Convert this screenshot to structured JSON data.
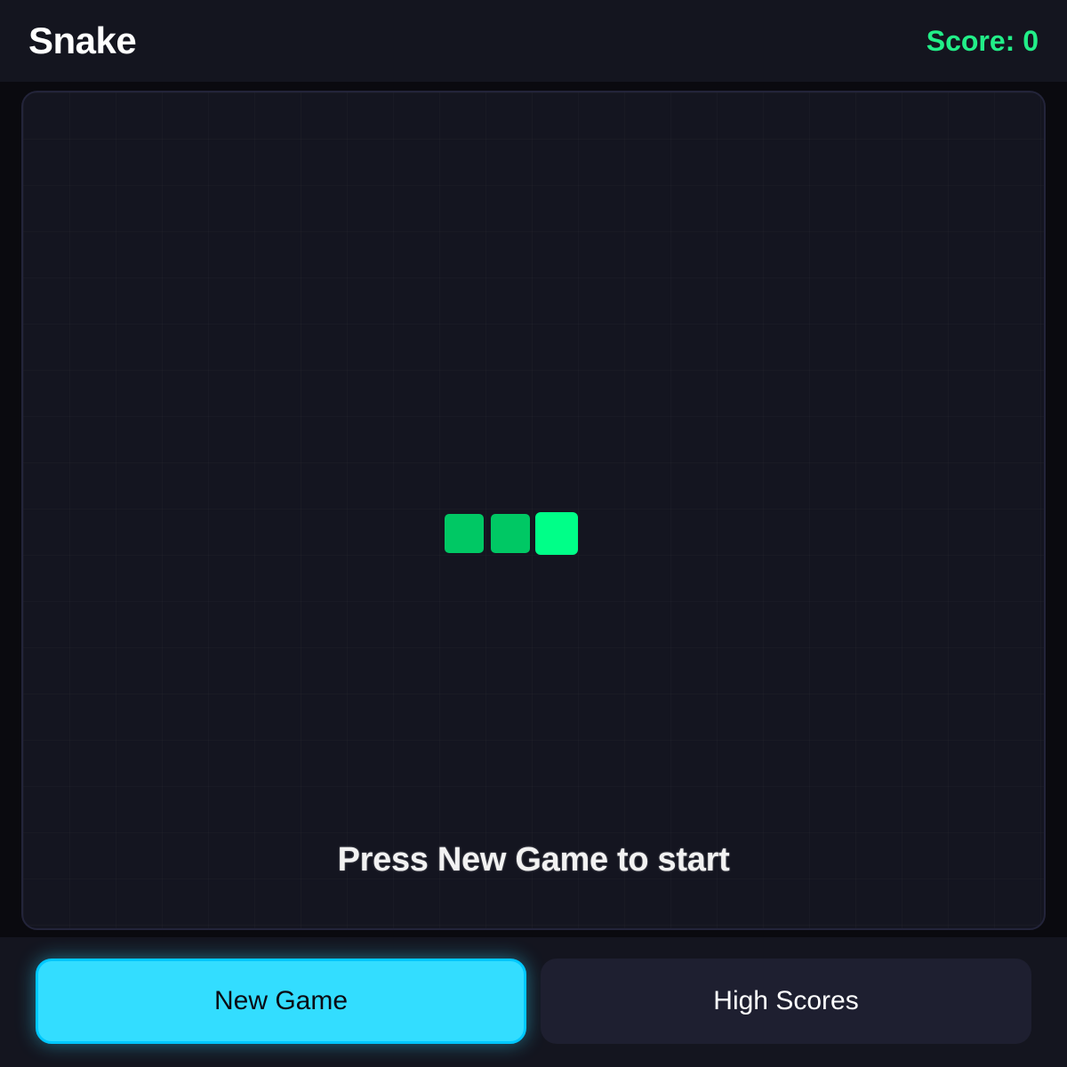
{
  "header": {
    "title": "Snake",
    "score_label": "Score: 0"
  },
  "board": {
    "message": "Press New Game to start",
    "snake_segments": [
      {
        "role": "body",
        "col": 0
      },
      {
        "role": "body",
        "col": 1
      },
      {
        "role": "head",
        "col": 2
      }
    ]
  },
  "footer": {
    "new_game_label": "New Game",
    "high_scores_label": "High Scores"
  },
  "colors": {
    "accent": "#33ddff",
    "score": "#22ee88",
    "snake_head": "#00ff88",
    "snake_body": "#00c864",
    "board_bg": "#141520"
  }
}
